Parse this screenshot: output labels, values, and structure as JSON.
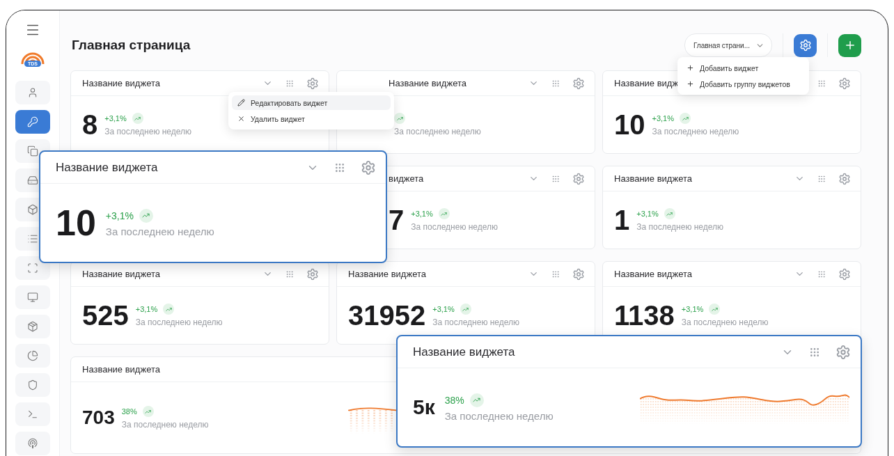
{
  "sidebar": {
    "items": [
      {
        "selected": false
      },
      {
        "selected": true
      },
      {
        "selected": false
      },
      {
        "selected": false
      },
      {
        "selected": false
      },
      {
        "selected": false
      },
      {
        "selected": false
      },
      {
        "selected": false
      },
      {
        "selected": false
      },
      {
        "selected": false
      },
      {
        "selected": false
      },
      {
        "selected": false
      },
      {
        "selected": false
      }
    ]
  },
  "logo": {
    "badge": "TDS"
  },
  "header": {
    "title": "Главная страница",
    "page_select": "Главная страни..."
  },
  "add_menu": {
    "items": [
      {
        "label": "Добавить виджет"
      },
      {
        "label": "Добавить группу виджетов"
      }
    ]
  },
  "widget_menu": {
    "items": [
      {
        "kind": "edit",
        "label": "Редактировать виджет",
        "selected": true
      },
      {
        "kind": "delete",
        "label": "Удалить виджет",
        "selected": false
      }
    ]
  },
  "widgets": [
    {
      "kind": "stat",
      "title": "Название виджета",
      "value": "8",
      "change": "+3,1%",
      "subtitle": "За последнею неделю",
      "collapsible": true,
      "tools": true
    },
    {
      "kind": "partial",
      "title": "Название виджета",
      "subtitle": "За последнею неделю",
      "collapsible": true,
      "tools": true
    },
    {
      "kind": "stat",
      "title": "Название видж",
      "value": "10",
      "change": "+3,1%",
      "subtitle": "За последнею неделю",
      "collapsible": false,
      "tools": true
    },
    {
      "kind": "empty"
    },
    {
      "kind": "partial",
      "title": "виджета",
      "value": "7",
      "change": "+3,1%",
      "subtitle": "За последнею неделю",
      "collapsible": true,
      "tools": true
    },
    {
      "kind": "stat",
      "title": "Название виджета",
      "value": "1",
      "change": "+3,1%",
      "subtitle": "За последнею неделю",
      "collapsible": true,
      "tools": true
    },
    {
      "kind": "stat",
      "title": "Название виджета",
      "value": "525",
      "change": "+3,1%",
      "subtitle": "За последнею неделю",
      "collapsible": true,
      "tools": true
    },
    {
      "kind": "stat",
      "title": "Название виджета",
      "value": "31952",
      "change": "+3,1%",
      "subtitle": "За последнею неделю",
      "collapsible": true,
      "tools": true
    },
    {
      "kind": "stat",
      "title": "Название виджета",
      "value": "1138",
      "change": "+3,1%",
      "subtitle": "За последнею неделю",
      "collapsible": true,
      "tools": true
    },
    {
      "kind": "sparkline",
      "title": "Название виджета",
      "value": "703",
      "change": "38%",
      "subtitle": "За последнею неделю",
      "collapsible": false,
      "tools": false
    }
  ],
  "floating_widgets": [
    {
      "kind": "stat",
      "title": "Название виджета",
      "value": "10",
      "change": "+3,1%",
      "subtitle": "За последнею неделю",
      "collapsible": true,
      "tools": true
    },
    {
      "kind": "sparkline",
      "title": "Название виджета",
      "value": "5к",
      "change": "38%",
      "subtitle": "За последнею неделю",
      "collapsible": true,
      "tools": true
    }
  ]
}
